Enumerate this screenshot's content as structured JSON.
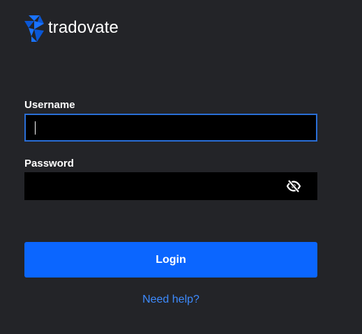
{
  "brand": {
    "name": "tradovate",
    "logo_icon": "tradovate-logo-icon",
    "accent_color": "#0b66ff"
  },
  "form": {
    "username": {
      "label": "Username",
      "value": ""
    },
    "password": {
      "label": "Password",
      "value": "",
      "toggle_icon": "eye-slash-icon"
    },
    "login_label": "Login",
    "help_label": "Need help?"
  },
  "colors": {
    "background": "#232428",
    "input_background": "#000000",
    "focus_border": "#2a6ed6",
    "link": "#3d8bff"
  }
}
